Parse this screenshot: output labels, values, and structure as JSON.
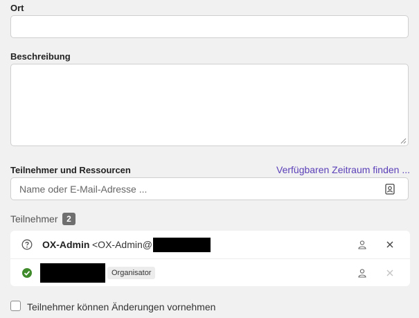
{
  "location": {
    "label": "Ort",
    "value": "",
    "placeholder": ""
  },
  "description": {
    "label": "Beschreibung",
    "value": ""
  },
  "participants_section": {
    "label": "Teilnehmer und Ressourcen",
    "find_slot_link": "Verfügbaren Zeitraum finden ...",
    "search": {
      "placeholder": "Name oder E-Mail-Adresse ...",
      "value": ""
    }
  },
  "participants": {
    "title": "Teilnehmer",
    "count": "2",
    "rows": [
      {
        "status": "unknown",
        "status_icon": "question-circle-icon",
        "name": "OX-Admin",
        "email": "<OX-Admin@"
      },
      {
        "status": "accepted",
        "status_icon": "check-circle-icon",
        "name": "",
        "role": "Organisator"
      }
    ]
  },
  "permissions": {
    "label": "Teilnehmer können Änderungen vornehmen",
    "checked": false
  },
  "colors": {
    "link": "#5a3fb8",
    "accepted": "#3f8a2a",
    "background": "#f1f1f1"
  }
}
